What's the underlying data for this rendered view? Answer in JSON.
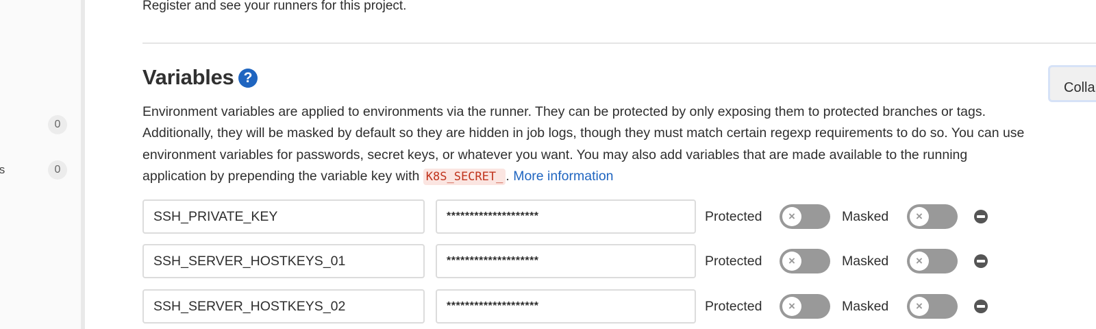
{
  "sidebar": {
    "items": [
      {
        "label": "",
        "count": "0"
      },
      {
        "label": "ts",
        "count": "0"
      }
    ]
  },
  "runners": {
    "description": "Register and see your runners for this project."
  },
  "variables": {
    "title": "Variables",
    "help_icon": "question-circle-icon",
    "collapse_label": "Collapse",
    "description_part1": "Environment variables are applied to environments via the runner. They can be protected by only exposing them to protected branches or tags. Additionally, they will be masked by default so they are hidden in job logs, though they must match certain regexp requirements to do so. You can use environment variables for passwords, secret keys, or whatever you want. You may also add variables that are made available to the running application by prepending the variable key with ",
    "code_prefix": "K8S_SECRET_",
    "description_part2": ". ",
    "more_info_link": "More information",
    "protected_label": "Protected",
    "masked_label": "Masked",
    "rows": [
      {
        "key": "SSH_PRIVATE_KEY",
        "value": "********************",
        "protected": false,
        "masked": false
      },
      {
        "key": "SSH_SERVER_HOSTKEYS_01",
        "value": "********************",
        "protected": false,
        "masked": false
      },
      {
        "key": "SSH_SERVER_HOSTKEYS_02",
        "value": "********************",
        "protected": false,
        "masked": false
      }
    ]
  },
  "colors": {
    "accent": "#1f65c0",
    "toggle_off": "#999999",
    "code_text": "#c0341d",
    "code_bg": "#fbe5e1"
  }
}
